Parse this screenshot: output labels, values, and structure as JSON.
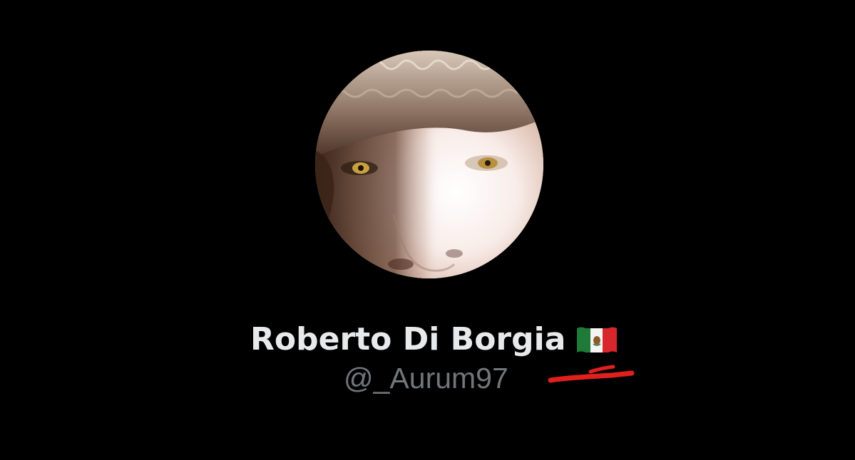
{
  "profile": {
    "display_name": "Roberto Di Borgia",
    "flag": "mexico-flag",
    "handle": "@_Aurum97"
  },
  "colors": {
    "background": "#000000",
    "name_text": "#e7e9ea",
    "handle_text": "#71767b",
    "annotation_stroke": "#e0201e"
  }
}
